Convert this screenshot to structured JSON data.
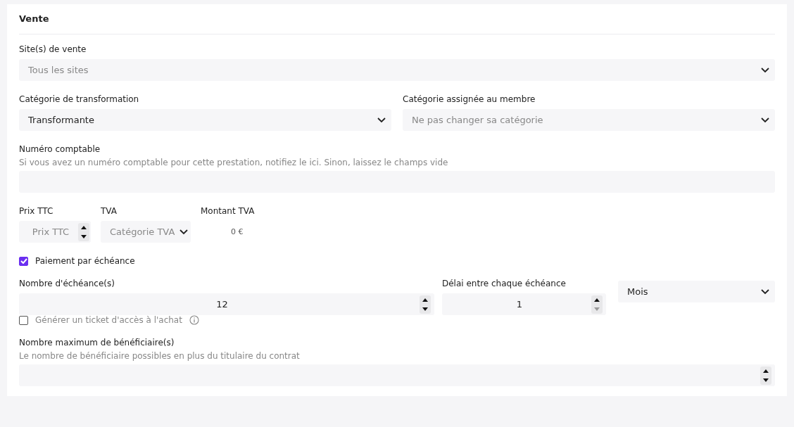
{
  "section": {
    "title": "Vente"
  },
  "sites": {
    "label": "Site(s) de vente",
    "placeholder": "Tous les sites"
  },
  "transformation": {
    "label": "Catégorie de transformation",
    "value": "Transformante"
  },
  "member_category": {
    "label": "Catégorie assignée au membre",
    "placeholder": "Ne pas changer sa catégorie"
  },
  "accounting_number": {
    "label": "Numéro comptable",
    "hint": "Si vous avez un numéro comptable pour cette prestation, notifiez le ici. Sinon, laissez le champs vide"
  },
  "price": {
    "label": "Prix TTC",
    "placeholder": "Prix TTC",
    "decrement_disabled": false
  },
  "vat": {
    "label": "TVA",
    "placeholder": "Catégorie TVA"
  },
  "vat_amount": {
    "label": "Montant TVA",
    "value": "0 €"
  },
  "installments_checkbox": {
    "label": "Paiement par échéance",
    "checked": true
  },
  "installments_count": {
    "label": "Nombre d'échéance(s)",
    "value": "12",
    "decrement_disabled": false
  },
  "installment_delay": {
    "label": "Délai entre chaque échéance",
    "value": "1",
    "decrement_disabled": true
  },
  "delay_unit": {
    "value": "Mois"
  },
  "ticket_checkbox": {
    "label": "Générer un ticket d'accès à l'achat",
    "checked": false
  },
  "max_beneficiaries": {
    "label": "Nombre maximum de bénéficiaire(s)",
    "hint": "Le nombre de bénéficiaire possibles en plus du titulaire du contrat",
    "decrement_disabled": false
  }
}
